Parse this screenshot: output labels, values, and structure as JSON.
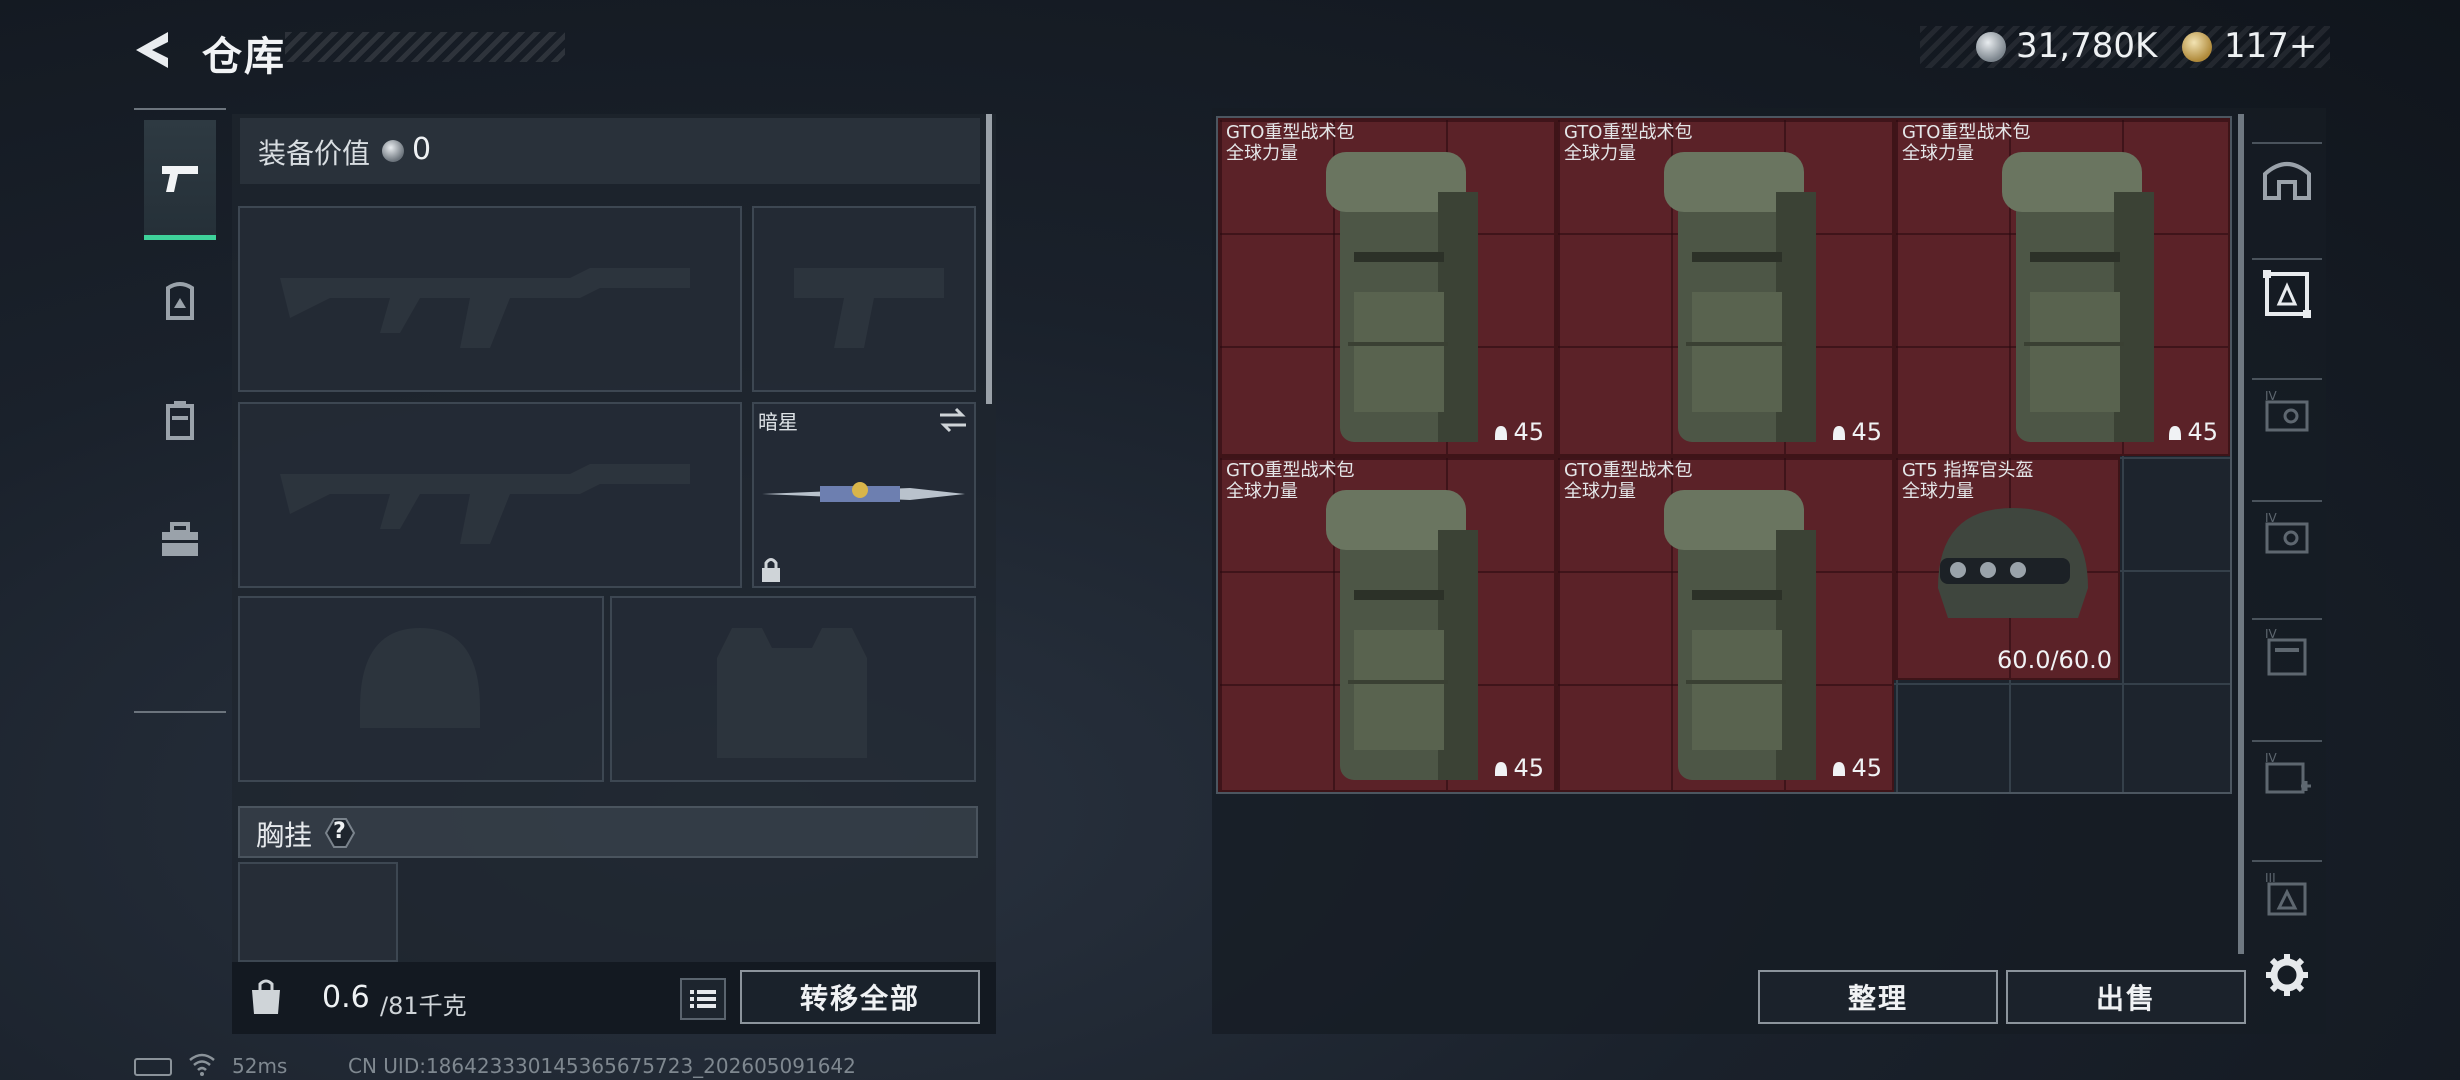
{
  "header": {
    "title": "仓库"
  },
  "currency": {
    "silver": "31,780K",
    "gold": "117+"
  },
  "equipment": {
    "value_label": "装备价值",
    "value": "0",
    "melee_name": "暗星",
    "chest_label": "胸挂",
    "chest_help": "?",
    "weight_value": "0.6",
    "weight_unit": "/81千克",
    "transfer_all": "转移全部"
  },
  "storage": {
    "items": [
      {
        "name": "GTO重型战术包",
        "sub": "全球力量",
        "qty": "45"
      },
      {
        "name": "GTO重型战术包",
        "sub": "全球力量",
        "qty": "45"
      },
      {
        "name": "GTO重型战术包",
        "sub": "全球力量",
        "qty": "45"
      },
      {
        "name": "GTO重型战术包",
        "sub": "全球力量",
        "qty": "45"
      },
      {
        "name": "GTO重型战术包",
        "sub": "全球力量",
        "qty": "45"
      },
      {
        "name": "GT5 指挥官头盔",
        "sub": "全球力量",
        "durability": "60.0/60.0"
      }
    ],
    "sort_label": "整理",
    "sell_label": "出售"
  },
  "status": {
    "ping": "52ms",
    "uid": "CN UID:186423330145365675723_202605091642"
  },
  "colors": {
    "accent": "#3ed29a",
    "item_bg": "#5b2228"
  }
}
